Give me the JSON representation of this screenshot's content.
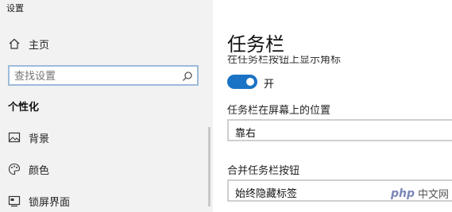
{
  "window": {
    "title": "设置"
  },
  "sidebar": {
    "home": {
      "label": "主页",
      "icon": "home-icon"
    },
    "search": {
      "placeholder": "查找设置",
      "icon": "search-icon"
    },
    "section": "个性化",
    "items": [
      {
        "label": "背景",
        "icon": "picture-icon"
      },
      {
        "label": "颜色",
        "icon": "palette-icon"
      },
      {
        "label": "锁屏界面",
        "icon": "lock-screen-icon"
      }
    ]
  },
  "main": {
    "title": "任务栏",
    "cut_label": "在任务栏按钮上显示角标",
    "toggle": {
      "state_label": "开",
      "on": true,
      "color": "#1a73c4"
    },
    "position": {
      "label": "任务栏在屏幕上的位置",
      "value": "靠右"
    },
    "combine": {
      "label": "合并任务栏按钮",
      "value": "始终隐藏标签"
    }
  },
  "watermark": {
    "logo": "php",
    "text": "中文网"
  }
}
